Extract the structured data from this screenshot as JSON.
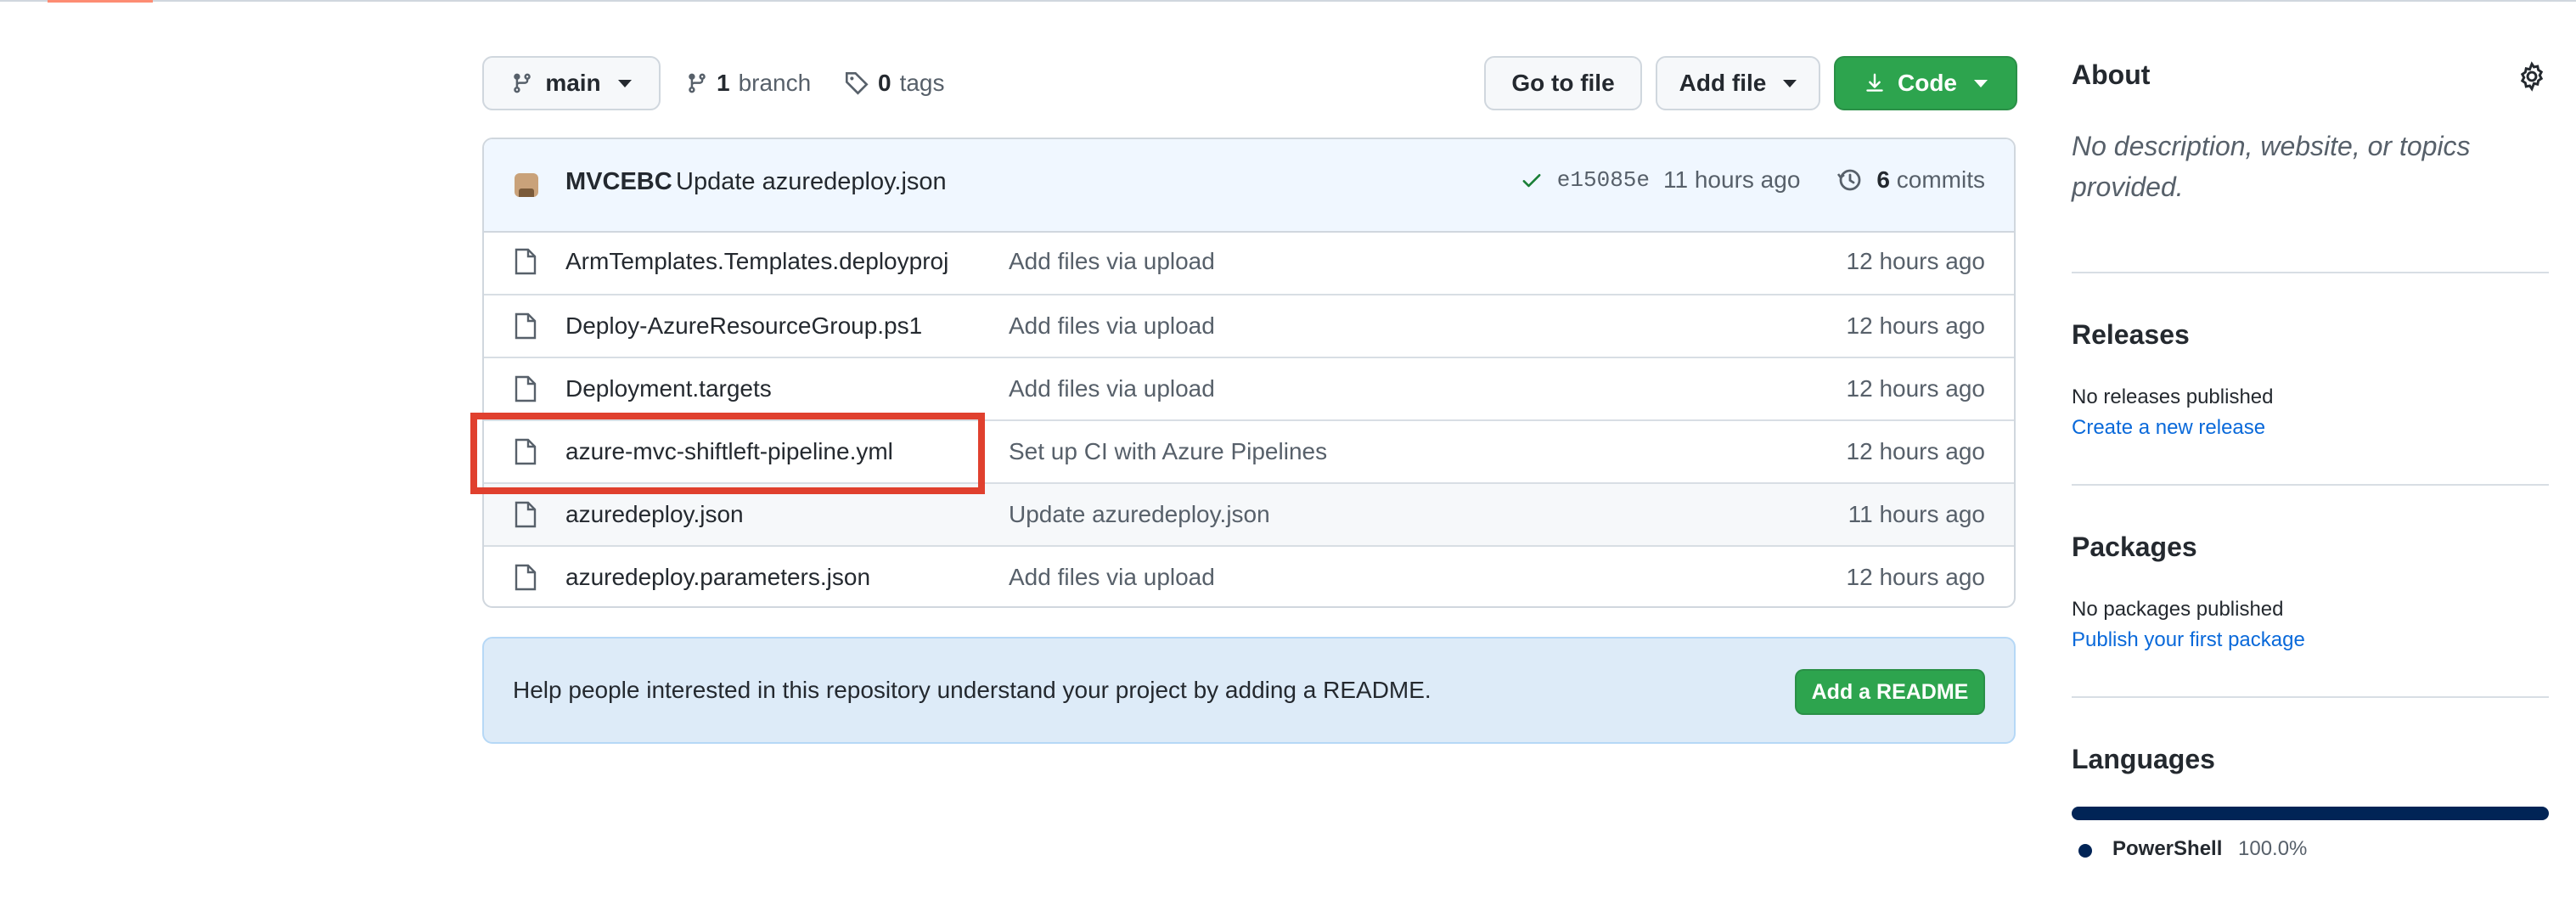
{
  "toolbar": {
    "branch_name": "main",
    "branch_count": "1",
    "branch_word": "branch",
    "tag_count": "0",
    "tag_word": "tags",
    "go_to_file_label": "Go to file",
    "add_file_label": "Add file",
    "code_label": "Code"
  },
  "latest_commit": {
    "author": "MVCEBC",
    "message": "Update azuredeploy.json",
    "sha": "e15085e",
    "age": "11 hours ago",
    "commit_count": "6",
    "commit_word": "commits"
  },
  "files": [
    {
      "name": "ArmTemplates.Templates.deployproj",
      "commit_message": "Add files via upload",
      "age": "12 hours ago"
    },
    {
      "name": "Deploy-AzureResourceGroup.ps1",
      "commit_message": "Add files via upload",
      "age": "12 hours ago"
    },
    {
      "name": "Deployment.targets",
      "commit_message": "Add files via upload",
      "age": "12 hours ago"
    },
    {
      "name": "azure-mvc-shiftleft-pipeline.yml",
      "commit_message": "Set up CI with Azure Pipelines",
      "age": "12 hours ago"
    },
    {
      "name": "azuredeploy.json",
      "commit_message": "Update azuredeploy.json",
      "age": "11 hours ago"
    },
    {
      "name": "azuredeploy.parameters.json",
      "commit_message": "Add files via upload",
      "age": "12 hours ago"
    }
  ],
  "readme_banner": {
    "text": "Help people interested in this repository understand your project by adding a README.",
    "button_label": "Add a README"
  },
  "sidebar": {
    "about_title": "About",
    "about_description": "No description, website, or topics provided.",
    "releases_title": "Releases",
    "releases_empty": "No releases published",
    "releases_link": "Create a new release",
    "packages_title": "Packages",
    "packages_empty": "No packages published",
    "packages_link": "Publish your first package",
    "languages_title": "Languages",
    "language_name": "PowerShell",
    "language_percent": "100.0%",
    "language_color": "#012456"
  },
  "colors": {
    "green_button": "#2da44e",
    "link_blue": "#0969da",
    "highlight_red": "#e0402e"
  }
}
